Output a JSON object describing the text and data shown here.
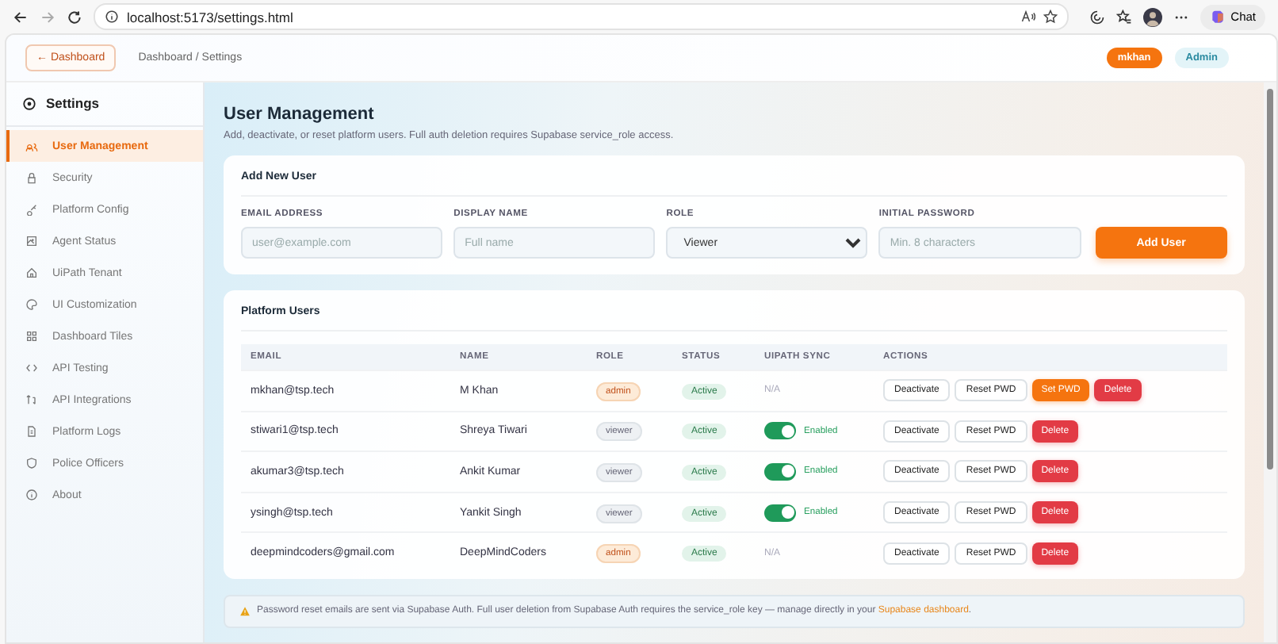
{
  "browser": {
    "address": "localhost:5173/settings.html",
    "chat_label": "Chat"
  },
  "header": {
    "back_button": "← Dashboard",
    "breadcrumb": "Dashboard / Settings",
    "user_badge": "mkhan",
    "role_badge": "Admin"
  },
  "sidebar": {
    "title": "Settings",
    "items": [
      {
        "label": "User Management",
        "selected": true
      },
      {
        "label": "Security",
        "selected": false
      },
      {
        "label": "Platform Config",
        "selected": false
      },
      {
        "label": "Agent Status",
        "selected": false
      },
      {
        "label": "UiPath Tenant",
        "selected": false
      },
      {
        "label": "UI Customization",
        "selected": false
      },
      {
        "label": "Dashboard Tiles",
        "selected": false
      },
      {
        "label": "API Testing",
        "selected": false
      },
      {
        "label": "API Integrations",
        "selected": false
      },
      {
        "label": "Platform Logs",
        "selected": false
      },
      {
        "label": "Police Officers",
        "selected": false
      },
      {
        "label": "About",
        "selected": false
      }
    ]
  },
  "page": {
    "title": "User Management",
    "subtitle": "Add, deactivate, or reset platform users. Full auth deletion requires Supabase service_role access."
  },
  "add_user": {
    "title": "Add New User",
    "fields": [
      {
        "kind": "input",
        "label": "EMAIL ADDRESS",
        "placeholder": "user@example.com"
      },
      {
        "kind": "input",
        "label": "DISPLAY NAME",
        "placeholder": "Full name"
      },
      {
        "kind": "select",
        "label": "ROLE",
        "value": "Viewer"
      },
      {
        "kind": "input",
        "label": "INITIAL PASSWORD",
        "placeholder": "Min. 8 characters"
      }
    ],
    "button": "Add User"
  },
  "users": {
    "title": "Platform Users",
    "columns": [
      "EMAIL",
      "NAME",
      "ROLE",
      "STATUS",
      "UIPATH SYNC",
      "ACTIONS"
    ],
    "rows": [
      {
        "email": "mkhan@tsp.tech",
        "name": "M Khan",
        "role": {
          "label": "admin",
          "kind": "admin"
        },
        "status": "Active",
        "sync": {
          "kind": "text",
          "label": "N/A"
        },
        "actions": [
          {
            "label": "Deactivate",
            "kind": "outline"
          },
          {
            "label": "Reset PWD",
            "kind": "outline"
          },
          {
            "label": "Set PWD",
            "kind": "warning"
          },
          {
            "label": "Delete",
            "kind": "danger"
          }
        ]
      },
      {
        "email": "stiwari1@tsp.tech",
        "name": "Shreya Tiwari",
        "role": {
          "label": "viewer",
          "kind": "viewer"
        },
        "status": "Active",
        "sync": {
          "kind": "toggle",
          "on": true,
          "label": "Enabled"
        },
        "actions": [
          {
            "label": "Deactivate",
            "kind": "outline"
          },
          {
            "label": "Reset PWD",
            "kind": "outline"
          },
          {
            "label": "Delete",
            "kind": "danger"
          }
        ]
      },
      {
        "email": "akumar3@tsp.tech",
        "name": "Ankit Kumar",
        "role": {
          "label": "viewer",
          "kind": "viewer"
        },
        "status": "Active",
        "sync": {
          "kind": "toggle",
          "on": true,
          "label": "Enabled"
        },
        "actions": [
          {
            "label": "Deactivate",
            "kind": "outline"
          },
          {
            "label": "Reset PWD",
            "kind": "outline"
          },
          {
            "label": "Delete",
            "kind": "danger"
          }
        ]
      },
      {
        "email": "ysingh@tsp.tech",
        "name": "Yankit Singh",
        "role": {
          "label": "viewer",
          "kind": "viewer"
        },
        "status": "Active",
        "sync": {
          "kind": "toggle",
          "on": true,
          "label": "Enabled"
        },
        "actions": [
          {
            "label": "Deactivate",
            "kind": "outline"
          },
          {
            "label": "Reset PWD",
            "kind": "outline"
          },
          {
            "label": "Delete",
            "kind": "danger"
          }
        ]
      },
      {
        "email": "deepmindcoders@gmail.com",
        "name": "DeepMindCoders",
        "role": {
          "label": "admin",
          "kind": "admin"
        },
        "status": "Active",
        "sync": {
          "kind": "text",
          "label": "N/A"
        },
        "actions": [
          {
            "label": "Deactivate",
            "kind": "outline"
          },
          {
            "label": "Reset PWD",
            "kind": "outline"
          },
          {
            "label": "Delete",
            "kind": "danger"
          }
        ]
      }
    ]
  },
  "notice": {
    "text": "Password reset emails are sent via Supabase Auth. Full user deletion from Supabase Auth requires the service_role key — manage directly in your ",
    "link": "Supabase dashboard",
    "after": "."
  }
}
